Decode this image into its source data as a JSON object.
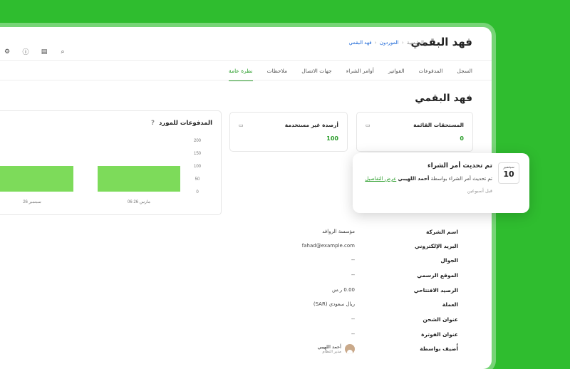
{
  "header": {
    "title": "فهد البقمي",
    "breadcrumb": [
      "الرئيسية",
      "الموردون",
      "فهد البقمي"
    ],
    "breadcrumb_sep": "‹",
    "tools": [
      "⌕",
      "▤",
      "ⓘ",
      "⚙"
    ]
  },
  "tabs": [
    "نظرة عامة",
    "ملاحظات",
    "جهات الاتصال",
    "أوامر الشراء",
    "الفواتير",
    "المدفوعات",
    "السجل"
  ],
  "section_title": "فهد البقمي",
  "cards": [
    {
      "label": "المستحقات القائمة",
      "value": "0",
      "icon": "▭"
    },
    {
      "label": "أرصدة غير مستخدمة",
      "value": "100",
      "icon": "▭"
    }
  ],
  "chart": {
    "title": "المدفوعات للمورد",
    "help": "?"
  },
  "chart_data": {
    "type": "bar",
    "title": "المدفوعات للمورد",
    "categories": [
      "26 سبتمبر",
      "06 مارس 26"
    ],
    "values": [
      100,
      100
    ],
    "ylim": [
      0,
      200
    ],
    "yticks": [
      "200",
      "150",
      "100",
      "50",
      "0"
    ],
    "color": "#7ddb5a"
  },
  "details": [
    {
      "label": "اسم الشركة",
      "value": "مؤسسة الروافد"
    },
    {
      "label": "البريد الإلكتروني",
      "value": "fahad@example.com"
    },
    {
      "label": "الجوال",
      "value": "--"
    },
    {
      "label": "الموقع الرسمي",
      "value": "--"
    },
    {
      "label": "الرصيد الافتتاحي",
      "value": "0.00 ر.س"
    },
    {
      "label": "العملة",
      "value": "ريال سعودي (SAR)"
    },
    {
      "label": "عنوان الشحن",
      "value": "--"
    },
    {
      "label": "عنوان الفوترة",
      "value": "--"
    }
  ],
  "created_by": {
    "label": "أُضيف بواسطة",
    "name": "أحمد اللهيبي",
    "role": "مدير النظام"
  },
  "toast": {
    "month": "سبتمبر",
    "day": "10",
    "title": "تم تحديث أمر الشراء",
    "body_prefix": "تم تحديث أمر الشراء بواسطة",
    "user": "أحمد اللهيبي",
    "link": "عرض التفاصيل",
    "time": "قبل أسبوعين"
  },
  "colors": {
    "accent": "#2a9d2a",
    "background": "#2fbd2f",
    "bar": "#7ddb5a"
  }
}
